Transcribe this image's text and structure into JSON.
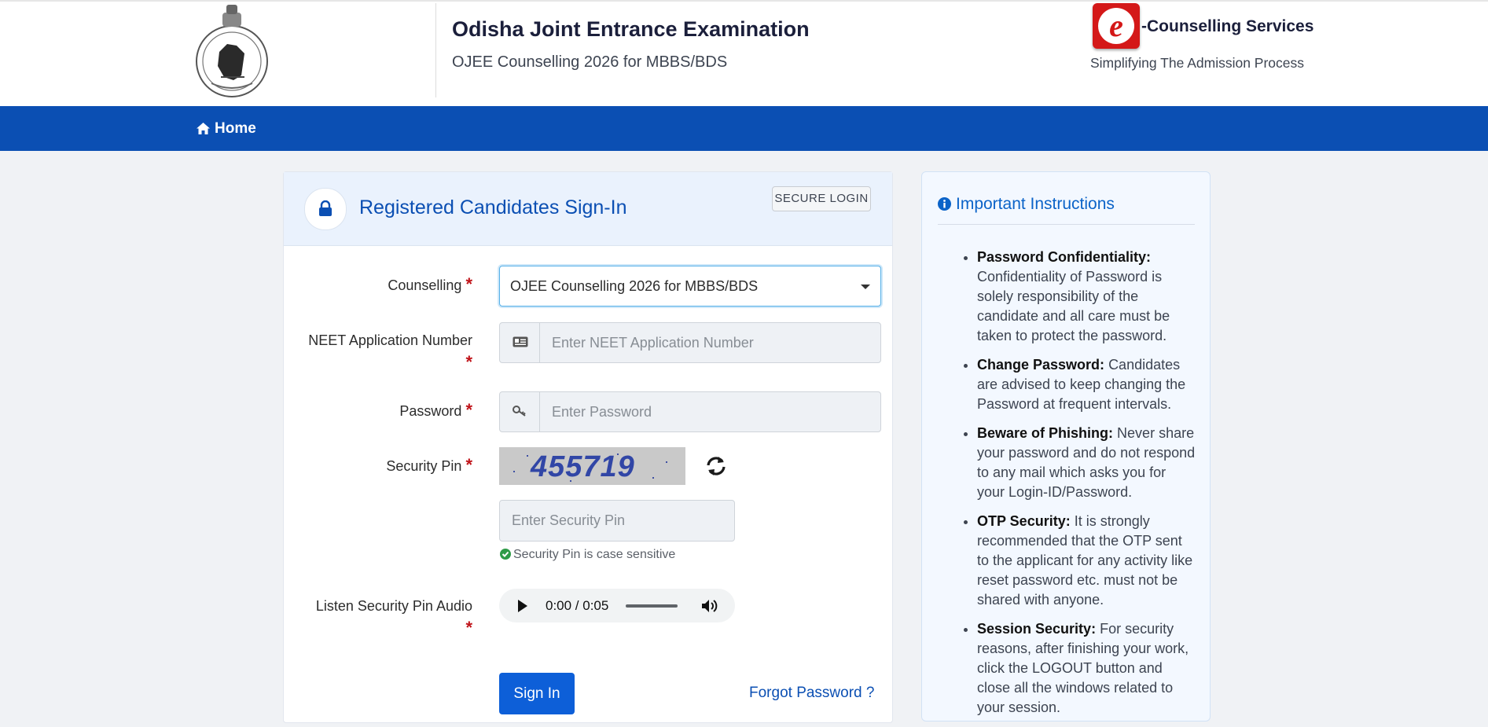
{
  "header": {
    "title": "Odisha Joint Entrance Examination",
    "subtitle": "OJEE Counselling 2026 for MBBS/BDS",
    "brand_title": "-Counselling Services",
    "brand_tagline": "Simplifying The Admission Process",
    "brand_logo_letter": "e"
  },
  "nav": {
    "home_label": "Home"
  },
  "login": {
    "title": "Registered Candidates Sign-In",
    "badge": "SECURE LOGIN",
    "fields": {
      "counselling": {
        "label": "Counselling",
        "value": "OJEE Counselling 2026 for MBBS/BDS"
      },
      "neet": {
        "label": "NEET Application Number",
        "placeholder": "Enter NEET Application Number"
      },
      "password": {
        "label": "Password",
        "placeholder": "Enter Password"
      },
      "security_pin": {
        "label": "Security Pin",
        "captcha_text": "455719",
        "placeholder": "Enter Security Pin",
        "hint": "Security Pin is case sensitive"
      },
      "audio": {
        "label": "Listen Security Pin Audio",
        "time": "0:00 / 0:05"
      }
    },
    "required_mark": "*",
    "signin_label": "Sign In",
    "forgot_label": "Forgot Password ?"
  },
  "instructions": {
    "title": "Important Instructions",
    "items": [
      {
        "heading": "Password Confidentiality:",
        "text": "Confidentiality of Password is solely responsibility of the candidate and all care must be taken to protect the password."
      },
      {
        "heading": "Change Password:",
        "text": "Candidates are advised to keep changing the Password at frequent intervals."
      },
      {
        "heading": "Beware of Phishing:",
        "text": "Never share your password and do not respond to any mail which asks you for your Login-ID/Password."
      },
      {
        "heading": "OTP Security:",
        "text": "It is strongly recommended that the OTP sent to the applicant for any activity like reset password etc. must not be shared with anyone."
      },
      {
        "heading": "Session Security:",
        "text": "For security reasons, after finishing your work, click the LOGOUT button and close all the windows related to your session."
      }
    ]
  },
  "colors": {
    "nav_blue": "#0b4fb3",
    "button_blue": "#0d5fd8",
    "required_red": "#c0141a",
    "brand_red": "#d41818"
  }
}
